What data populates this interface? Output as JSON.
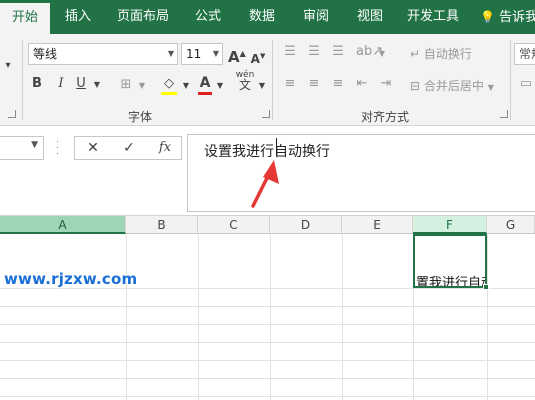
{
  "ribbon_tabs": [
    "开始",
    "插入",
    "页面布局",
    "公式",
    "数据",
    "审阅",
    "视图",
    "开发工具",
    "告诉我"
  ],
  "font_group": {
    "font_name": "等线",
    "font_size": "11",
    "grow_font": "A",
    "shrink_font": "A",
    "bold": "B",
    "italic": "I",
    "underline": "U",
    "phonetic": "wén",
    "font_color_letter": "A",
    "label": "字体"
  },
  "alignment_group": {
    "wrap_text": "自动换行",
    "merge_center": "合并后居中",
    "label": "对齐方式"
  },
  "number_group": {
    "format_partial": "常规"
  },
  "formula_bar": {
    "cancel": "✕",
    "enter": "✓",
    "fx": "fx",
    "text_before_caret": "设置我进行",
    "text_after_caret": "自动换行"
  },
  "columns": [
    "A",
    "B",
    "C",
    "D",
    "E",
    "F",
    "G"
  ],
  "selected_column": "F",
  "cell_F_visible_text": "置我进行自动",
  "watermark": "www.rjzxw.com",
  "colors": {
    "accent": "#217346",
    "annotation_arrow": "#e53935"
  }
}
